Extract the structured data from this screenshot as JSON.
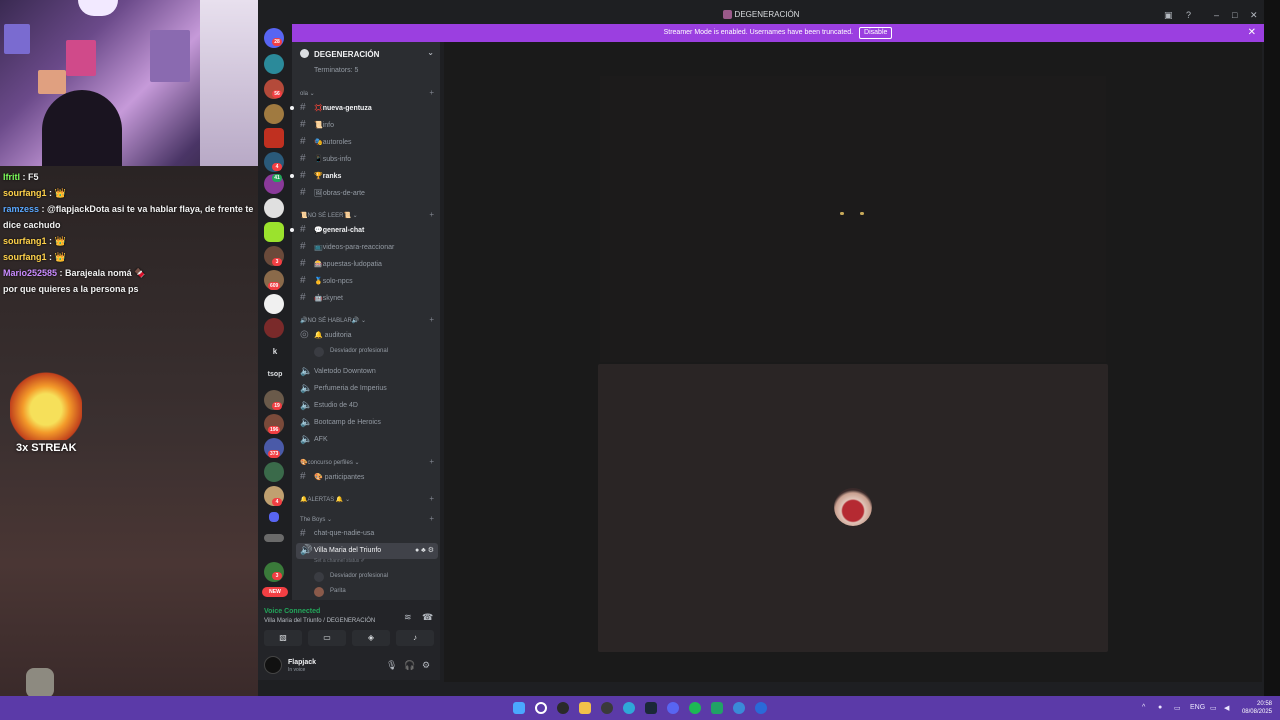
{
  "stream": {
    "chat": [
      {
        "user": "Ifritl",
        "text": " : F5"
      },
      {
        "user": "sourfang1",
        "text": " : 👑"
      },
      {
        "user": "ramzess",
        "text": " : @flapjackDota asi te va hablar flaya, de frente te dice cachudo"
      },
      {
        "user": "sourfang1",
        "text": " : 👑"
      },
      {
        "user": "sourfang1",
        "text": " : 👑"
      },
      {
        "user": "Mario252585",
        "text": " : Barajeala nomá 🍫"
      },
      {
        "user": "",
        "text": "por que quieres a la persona ps"
      }
    ],
    "streak_label": "3x STREAK"
  },
  "window": {
    "title": "DEGENERACIÓN",
    "streamer_banner": "Streamer Mode is enabled. Usernames have been truncated.",
    "disable_label": "Disable"
  },
  "servers": {
    "badges": [
      "28",
      "56",
      "4",
      "41",
      "3",
      "609",
      "19",
      "196",
      "373",
      "4",
      "3"
    ],
    "letters": {
      "k": "k",
      "tsop": "tsop"
    },
    "new_label": "NEW"
  },
  "sidebar": {
    "server_name": "DEGENERACIÓN",
    "terminators": "Terminators: 5",
    "categories": {
      "ola": "ola ⌄",
      "no_se_leer": "📜NO SÉ LEER📜 ⌄",
      "no_se_hablar": "🔊NO SÉ HABLAR🔊 ⌄",
      "concurso": "🎨concurso perfiles ⌄",
      "alertas": "🔔ALERTAS 🔔 ⌄",
      "the_boys": "The Boys ⌄"
    },
    "channels": {
      "nueva_gentuza": "💢nueva-gentuza",
      "info": "📜info",
      "autoroles": "🎭autoroles",
      "subs_info": "📱subs-info",
      "ranks": "🏆ranks",
      "obras": "🖼obras-de-arte",
      "general": "💬general-chat",
      "videos": "📺videos-para-reaccionar",
      "apuestas": "🎰apuestas-ludopatia",
      "solo_npcs": "🥇solo-npcs",
      "skynet": "🤖skynet",
      "auditoria": "🔔 auditoria",
      "desviador1": "Desviador profesional",
      "valetodo": "Valetodo Downtown",
      "perfumeria": "Perfumeria de Imperius",
      "estudio": "Estudio de 4D",
      "bootcamp": "Bootcamp de Heroics",
      "afk": "AFK",
      "participantes": "🎨 participantes",
      "chat_nadie": "chat-que-nadie-usa",
      "villa": "Villa Maria del Triunfo",
      "set_status": "Set a channel status ✐",
      "desviador2": "Desviador profesional",
      "parita": "Parita"
    }
  },
  "voice": {
    "title": "Voice Connected",
    "sub": "Villa Maria del Triunfo / DEGENERACIÓN"
  },
  "user": {
    "name": "Flapjack",
    "status": "In voice"
  },
  "clock": {
    "lang": "ENG",
    "time": "20:58",
    "date": "08/08/2025"
  },
  "colors": {
    "accent": "#9b3fe0",
    "voice_green": "#23a55a",
    "badge_red": "#f23f43"
  }
}
